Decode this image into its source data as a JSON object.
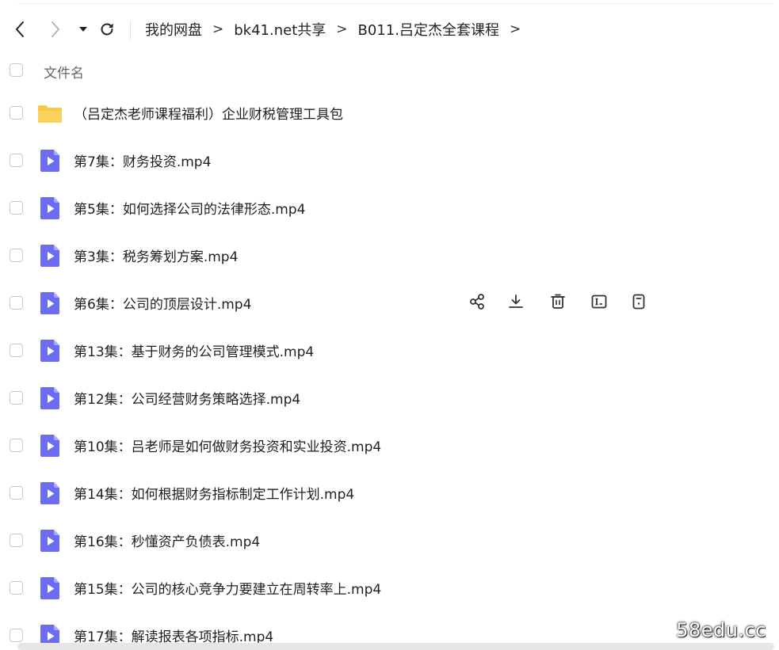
{
  "breadcrumb": {
    "items": [
      "我的网盘",
      "bk41.net共享",
      "B011.吕定杰全套课程"
    ],
    "separator": ">"
  },
  "header": {
    "column_label": "文件名"
  },
  "files": [
    {
      "name": "（吕定杰老师课程福利）企业财税管理工具包",
      "type": "folder"
    },
    {
      "name": "第7集：财务投资.mp4",
      "type": "video"
    },
    {
      "name": "第5集：如何选择公司的法律形态.mp4",
      "type": "video"
    },
    {
      "name": "第3集：税务筹划方案.mp4",
      "type": "video"
    },
    {
      "name": "第6集：公司的顶层设计.mp4",
      "type": "video"
    },
    {
      "name": "第13集：基于财务的公司管理模式.mp4",
      "type": "video"
    },
    {
      "name": "第12集：公司经营财务策略选择.mp4",
      "type": "video"
    },
    {
      "name": "第10集：吕老师是如何做财务投资和实业投资.mp4",
      "type": "video"
    },
    {
      "name": "第14集：如何根据财务指标制定工作计划.mp4",
      "type": "video"
    },
    {
      "name": "第16集：秒懂资产负债表.mp4",
      "type": "video"
    },
    {
      "name": "第15集：公司的核心竞争力要建立在周转率上.mp4",
      "type": "video"
    },
    {
      "name": "第17集：解读报表各项指标.mp4",
      "type": "video"
    }
  ],
  "row_actions": [
    "share-icon",
    "download-icon",
    "delete-icon",
    "rename-icon",
    "more-icon"
  ],
  "watermark": "58edu.cc",
  "colors": {
    "folder": "#F7C948",
    "video_file": "#6C6CF0",
    "video_file_fold": "#A9A9F7",
    "icon": "#333333"
  }
}
